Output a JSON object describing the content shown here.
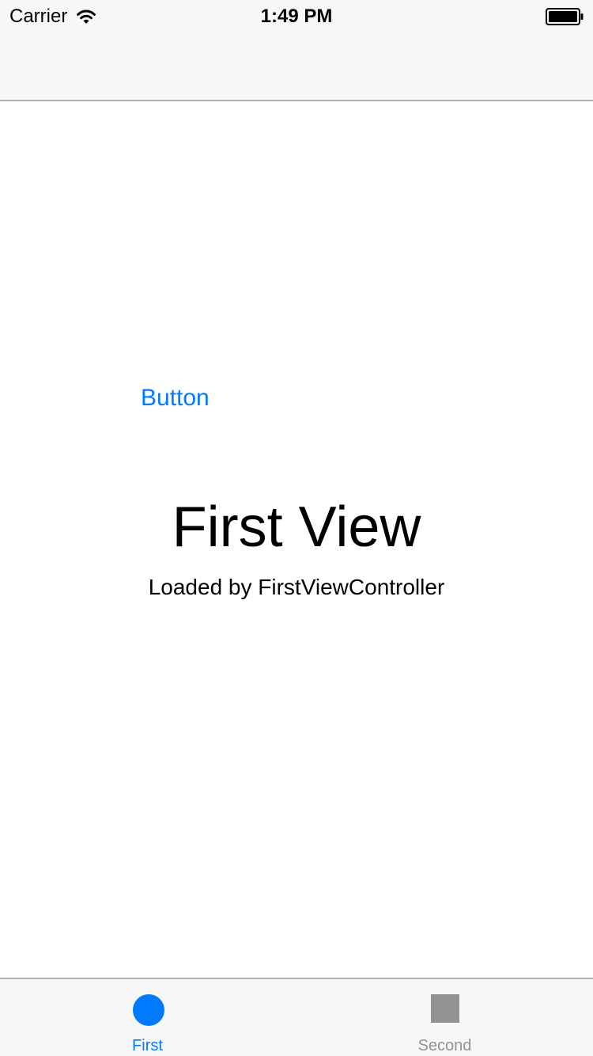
{
  "status_bar": {
    "carrier": "Carrier",
    "time": "1:49 PM",
    "wifi_icon": "wifi-icon",
    "battery_icon": "battery-full-icon"
  },
  "content": {
    "button_label": "Button",
    "title": "First View",
    "subtitle": "Loaded by FirstViewController"
  },
  "tab_bar": {
    "tabs": [
      {
        "label": "First",
        "icon": "circle-icon",
        "selected": true
      },
      {
        "label": "Second",
        "icon": "square-icon",
        "selected": false
      }
    ]
  },
  "colors": {
    "accent": "#007aff",
    "inactive": "#929292",
    "bar_background": "#f7f7f7",
    "separator": "#b2b2b2"
  }
}
